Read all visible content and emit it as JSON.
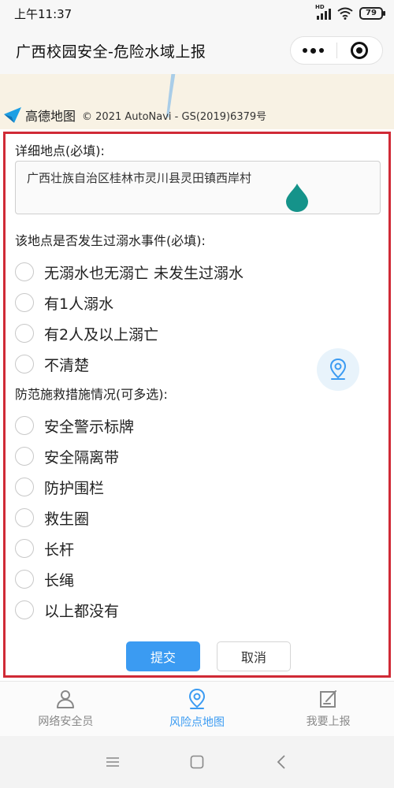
{
  "status": {
    "time": "上午11:37",
    "network": "HD",
    "battery": "79"
  },
  "header": {
    "title": "广西校园安全-危险水域上报"
  },
  "map": {
    "provider": "高德地图",
    "copyright": "© 2021 AutoNavi - GS(2019)6379号"
  },
  "form": {
    "address": {
      "label": "详细地点(必填):",
      "value": "广西壮族自治区桂林市灵川县灵田镇西岸村"
    },
    "drowning": {
      "label": "该地点是否发生过溺水事件(必填):",
      "options": [
        "无溺水也无溺亡 未发生过溺水",
        "有1人溺水",
        "有2人及以上溺亡",
        "不清楚"
      ]
    },
    "measures": {
      "label": "防范施救措施情况(可多选):",
      "options": [
        "安全警示标牌",
        "安全隔离带",
        "防护围栏",
        "救生圈",
        "长杆",
        "长绳",
        "以上都没有"
      ]
    },
    "submit_label": "提交",
    "cancel_label": "取消"
  },
  "tabs": [
    {
      "label": "网络安全员",
      "icon": "person-icon"
    },
    {
      "label": "风险点地图",
      "icon": "map-pin-icon"
    },
    {
      "label": "我要上报",
      "icon": "edit-icon"
    }
  ],
  "colors": {
    "accent": "#3b9bf2",
    "border": "#d02a36",
    "marker": "#15938a"
  }
}
